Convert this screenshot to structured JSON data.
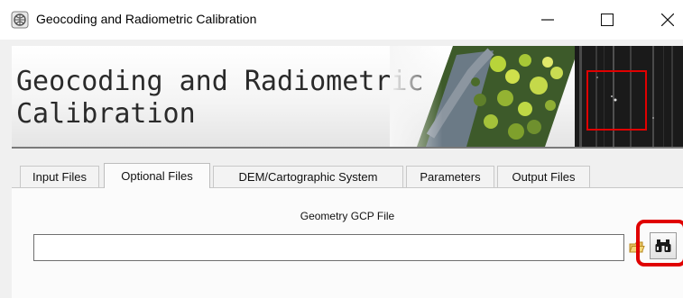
{
  "window": {
    "title": "Geocoding and Radiometric Calibration",
    "icon": "app-globe-icon",
    "controls": {
      "minimize": "minimize-icon",
      "maximize": "maximize-icon",
      "close": "close-icon"
    }
  },
  "banner": {
    "title": "Geocoding and Radiometric\nCalibration",
    "image": "satellite-imagery-thumbnails",
    "highlight_color": "#e00000"
  },
  "tabs": [
    {
      "label": "Input Files",
      "active": false
    },
    {
      "label": "Optional Files",
      "active": true
    },
    {
      "label": "DEM/Cartographic System",
      "active": false
    },
    {
      "label": "Parameters",
      "active": false
    },
    {
      "label": "Output Files",
      "active": false
    }
  ],
  "optional_files": {
    "field_label": "Geometry GCP File",
    "value": "",
    "folder_icon": "folder-open-icon",
    "browse_icon": "binoculars-icon"
  },
  "annotation": {
    "color": "#e00000"
  }
}
